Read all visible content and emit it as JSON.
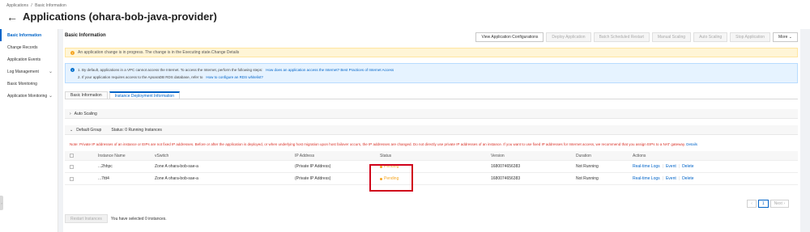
{
  "breadcrumb": [
    "Applications",
    "/",
    "Basic Information"
  ],
  "title": "Applications (ohara-bob-java-provider)",
  "sidebar": [
    {
      "label": "Basic Information",
      "active": true,
      "chevron": false
    },
    {
      "label": "Change Records",
      "active": false,
      "chevron": false
    },
    {
      "label": "Application Events",
      "active": false,
      "chevron": false
    },
    {
      "label": "Log Management",
      "active": false,
      "chevron": true
    },
    {
      "label": "Basic Monitoring",
      "active": false,
      "chevron": false
    },
    {
      "label": "Application Monitoring",
      "active": false,
      "chevron": true
    }
  ],
  "section_title": "Basic Information",
  "toolbar": [
    {
      "label": "View Application Configurations",
      "disabled": false
    },
    {
      "label": "Deploy Application",
      "disabled": true
    },
    {
      "label": "Batch Scheduled Restart",
      "disabled": true
    },
    {
      "label": "Manual Scaling",
      "disabled": true
    },
    {
      "label": "Auto Scaling",
      "disabled": true
    },
    {
      "label": "Stop Application",
      "disabled": true
    },
    {
      "label": "More",
      "disabled": false
    }
  ],
  "warning": "An application change is in progress. The change is in the Executing state.Change Details",
  "info": {
    "line1": "1. By default, applications in a VPC cannot access the Internet. To access the Internet, perform the following steps:",
    "line1_link": "How does an application access the Internet? Best Practices of Internet Access",
    "line2": "2. If your application requires access to the ApsaraDB RDS database, refer to",
    "line2_link": "How to configure an RDS whitelist?"
  },
  "tabs": [
    "Basic Information",
    "Instance Deployment Information"
  ],
  "auto_scaling": "Auto Scaling",
  "group": {
    "name": "Default Group",
    "status": "Status: 0 Running Instances"
  },
  "note": "Note: Private IP addresses of an instance or EIPs are not fixed IP addresses. Before or after the application is deployed, or when underlying host migration upon host failover occurs, the IP addresses are changed. Do not directly use private IP addresses of an instance. If you want to use fixed IP addresses for Internet access, we recommend that you assign EIPs to a NAT gateway.",
  "note_link": "Details",
  "columns": [
    "Instance Name",
    "vSwitch",
    "IP Address",
    "Status",
    "Version",
    "Duration",
    "Actions"
  ],
  "rows": [
    {
      "name": "...2hhpc",
      "vswitch": "Zone A ohara-bob-sae-a",
      "ip": "(Private IP Address)",
      "status": "Pending",
      "version": "1680074656383",
      "duration": "Not Running"
    },
    {
      "name": "...7ttt4",
      "vswitch": "Zone A ohara-bob-sae-a",
      "ip": "(Private IP Address)",
      "status": "Pending",
      "version": "1680074656383",
      "duration": "Not Running"
    }
  ],
  "row_actions": [
    "Real-time Logs",
    "Event",
    "Delete"
  ],
  "pager": {
    "prev": "Previous",
    "page": "1",
    "next": "Next"
  },
  "footer": {
    "button": "Restart Instances",
    "text": "You have selected 0 instances."
  }
}
